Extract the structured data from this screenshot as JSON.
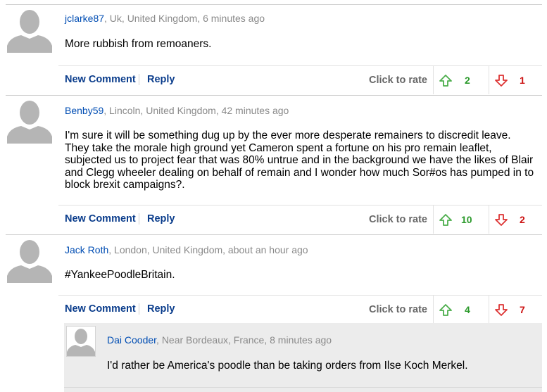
{
  "comments": [
    {
      "username": "jclarke87",
      "location_time": ", Uk, United Kingdom, 6 minutes ago",
      "text": "More rubbish from remoaners.",
      "new_comment": "New Comment",
      "reply": "Reply",
      "rate_label": "Click to rate",
      "up_votes": "2",
      "down_votes": "1"
    },
    {
      "username": "Benby59",
      "location_time": ", Lincoln, United Kingdom, 42 minutes ago",
      "text": "I'm sure it will be something dug up by the ever more desperate remainers to discredit leave. They take the morale high ground yet Cameron spent a fortune on his pro remain leaflet, subjected us to project fear that was 80% untrue and in the background we have the likes of Blair and Clegg wheeler dealing on behalf of remain and I wonder how much Sor#os has pumped in to block brexit campaigns?.",
      "new_comment": "New Comment",
      "reply": "Reply",
      "rate_label": "Click to rate",
      "up_votes": "10",
      "down_votes": "2"
    },
    {
      "username": "Jack Roth",
      "location_time": ", London, United Kingdom, about an hour ago",
      "text": "#YankeePoodleBritain.",
      "new_comment": "New Comment",
      "reply": "Reply",
      "rate_label": "Click to rate",
      "up_votes": "4",
      "down_votes": "7"
    }
  ],
  "reply": {
    "username": "Dai Cooder",
    "location_time": ", Near Bordeaux, France, 8 minutes ago",
    "text": "I'd rather be America's poodle than be taking orders from Ilse Koch Merkel."
  },
  "icons": {
    "avatar": "default-user-silhouette-icon",
    "up": "thumb-up-arrow-icon",
    "down": "thumb-down-arrow-icon"
  },
  "colors": {
    "username": "#004db3",
    "action_link": "#0b3d8c",
    "up_count": "#2c9a2c",
    "down_count": "#cc1111",
    "reply_background": "#ececec"
  }
}
